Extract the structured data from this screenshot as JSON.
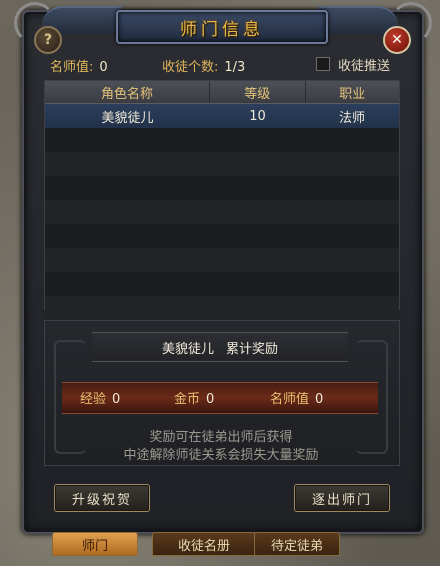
{
  "title": "师门信息",
  "stats": {
    "fame_label": "名师值:",
    "fame_value": "0",
    "disciples_label": "收徒个数:",
    "disciples_value": "1/3",
    "push_label": "收徒推送",
    "push_checked": false
  },
  "table": {
    "headers": [
      "角色名称",
      "等级",
      "职业"
    ],
    "rows": [
      {
        "name": "美貌徒儿",
        "level": "10",
        "job": "法师"
      }
    ]
  },
  "reward": {
    "disciple": "美貌徒儿",
    "title_suffix": "累计奖励",
    "items": [
      {
        "label": "经验",
        "value": "0"
      },
      {
        "label": "金币",
        "value": "0"
      },
      {
        "label": "名师值",
        "value": "0"
      }
    ],
    "note1": "奖励可在徒弟出师后获得",
    "note2": "中途解除师徒关系会损失大量奖励"
  },
  "buttons": {
    "upgrade": "升级祝贺",
    "expel": "逐出师门"
  },
  "tabs": [
    "师门",
    "收徒名册",
    "待定徒弟"
  ],
  "icons": {
    "help": "question-icon",
    "close": "close-icon"
  },
  "colors": {
    "accent": "#e0b55a",
    "selected_row": "#2b3e5c",
    "active_tab": "#e0a050"
  }
}
